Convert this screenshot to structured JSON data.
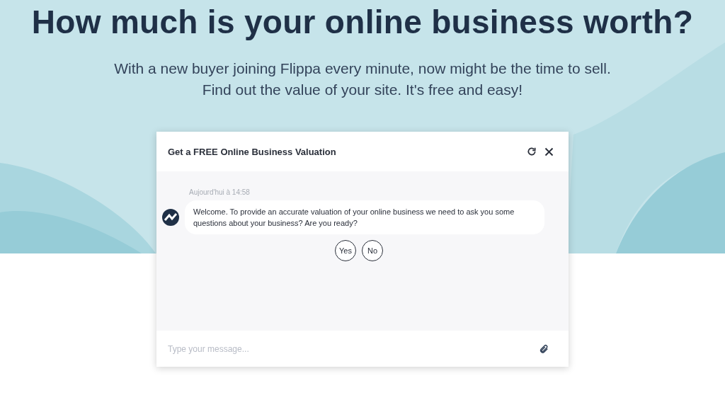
{
  "hero": {
    "title": "How much is your online business worth?",
    "subtitle_lines": [
      "With a new buyer joining Flippa every minute, now might be the time to sell.",
      "Find out the value of your site. It's free and easy!"
    ]
  },
  "chat": {
    "title": "Get a FREE Online Business Valuation",
    "timestamp": "Aujourd'hui à 14:58",
    "message": "Welcome. To provide an accurate valuation of your online business we need to ask you some questions about your business? Are you ready?",
    "replies": [
      "Yes",
      "No"
    ],
    "input": {
      "placeholder": "Type your message..."
    }
  }
}
